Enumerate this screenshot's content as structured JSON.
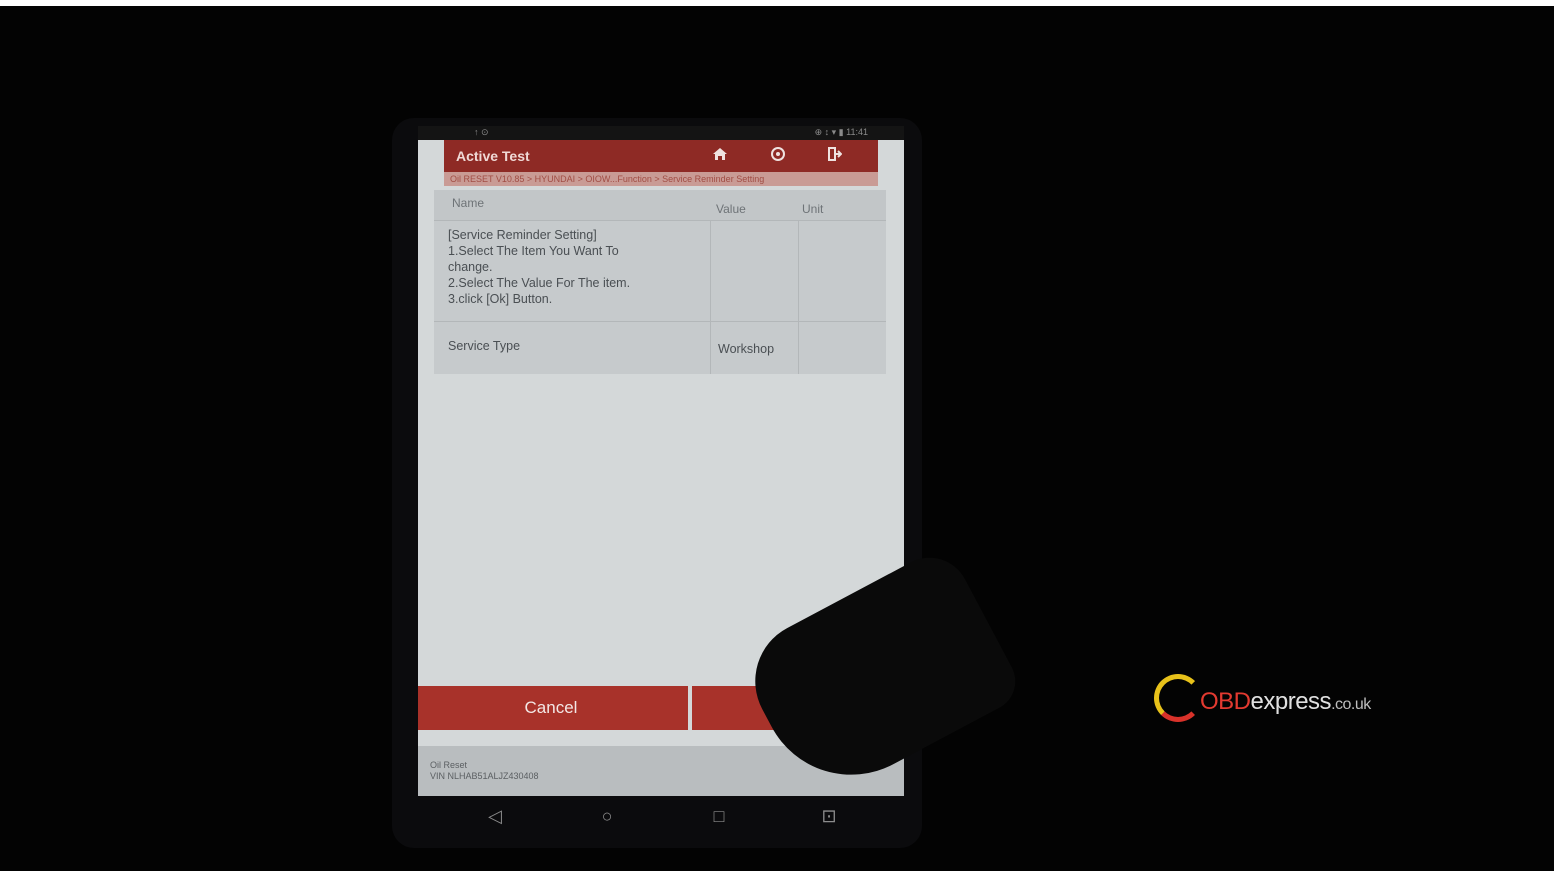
{
  "status_bar": {
    "left": "↑ ⊙",
    "right": "⊕ ↕ ▾ ▮ 11:41"
  },
  "title_bar": {
    "title": "Active Test",
    "home_icon": "home-icon",
    "print_icon": "print-icon",
    "exit_icon": "exit-icon"
  },
  "breadcrumb": "Oil RESET V10.85 > HYUNDAI > OIOW...Function > Service Reminder Setting",
  "table": {
    "headers": {
      "name": "Name",
      "value": "Value",
      "unit": "Unit"
    },
    "rows": [
      {
        "name_lines": [
          "[Service Reminder Setting]",
          "1.Select The Item You Want To",
          "change.",
          "2.Select The Value For The item.",
          "3.click [Ok] Button."
        ],
        "value": "",
        "unit": ""
      },
      {
        "name_lines": [
          "Service Type"
        ],
        "value": "Workshop",
        "unit": ""
      }
    ]
  },
  "buttons": {
    "cancel": "Cancel",
    "ok": ""
  },
  "footer": {
    "line1": "Oil Reset",
    "line2": "VIN NLHAB51ALJZ430408"
  },
  "navbar": {
    "back": "◁",
    "home": "○",
    "recents": "□",
    "screenshot": "⊡"
  },
  "watermark": {
    "brand_red": "OBD",
    "brand_white": "express",
    "domain": ".co.uk"
  },
  "colors": {
    "accent": "#a8322a",
    "title_bar": "#8e2a25",
    "screen_bg": "#d4d8d9"
  }
}
